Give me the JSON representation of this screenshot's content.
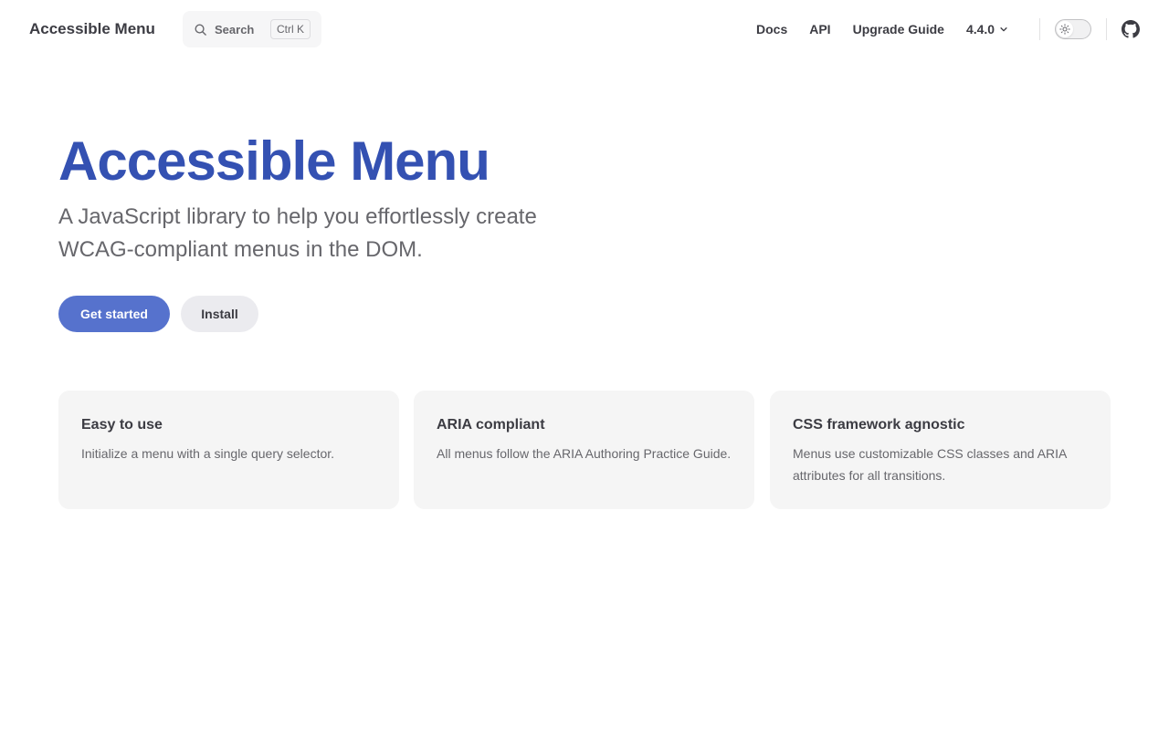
{
  "navbar": {
    "site_title": "Accessible Menu",
    "search": {
      "label": "Search",
      "shortcut_mod": "Ctrl",
      "shortcut_key": "K"
    },
    "links": [
      {
        "label": "Docs"
      },
      {
        "label": "API"
      },
      {
        "label": "Upgrade Guide"
      }
    ],
    "version": "4.4.0",
    "theme_toggle_icon": "sun-icon",
    "social_icon": "github-icon"
  },
  "hero": {
    "name": "Accessible Menu",
    "tagline": "A JavaScript library to help you effortlessly create WCAG-compliant menus in the DOM.",
    "actions": [
      {
        "label": "Get started",
        "theme": "brand"
      },
      {
        "label": "Install",
        "theme": "alt"
      }
    ]
  },
  "features": [
    {
      "title": "Easy to use",
      "details": "Initialize a menu with a single query selector."
    },
    {
      "title": "ARIA compliant",
      "details": "All menus follow the ARIA Authoring Practice Guide."
    },
    {
      "title": "CSS framework agnostic",
      "details": "Menus use customizable CSS classes and ARIA attributes for all transitions."
    }
  ],
  "colors": {
    "brand": "#3451b2",
    "brand_button": "#5672cd",
    "text_1": "#3c3c43",
    "text_2": "#67676c",
    "feature_bg": "#f5f5f5"
  }
}
